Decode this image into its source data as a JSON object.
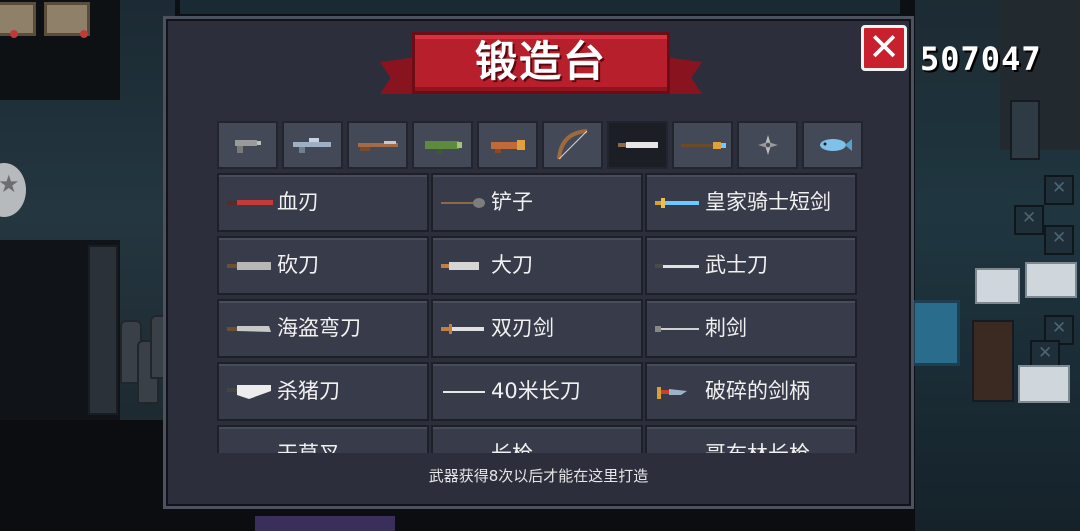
{
  "window": {
    "title": "锻造台"
  },
  "currency": {
    "gems": "507047"
  },
  "close_button": {
    "label": "✕"
  },
  "categories": [
    {
      "icon": "pistol-icon",
      "active": false
    },
    {
      "icon": "rifle-icon",
      "active": false
    },
    {
      "icon": "shotgun-icon",
      "active": false
    },
    {
      "icon": "rocket-launcher-icon",
      "active": false
    },
    {
      "icon": "special-gun-icon",
      "active": false
    },
    {
      "icon": "bow-icon",
      "active": false
    },
    {
      "icon": "blade-icon",
      "active": true
    },
    {
      "icon": "spear-icon",
      "active": false
    },
    {
      "icon": "shuriken-icon",
      "active": false
    },
    {
      "icon": "fish-icon",
      "active": false
    }
  ],
  "weapons": [
    {
      "name": "血刃",
      "icon": "blood-blade-icon",
      "color": "#c23a3a"
    },
    {
      "name": "铲子",
      "icon": "shovel-icon",
      "color": "#7d7d7d"
    },
    {
      "name": "皇家骑士短剑",
      "icon": "royal-knight-sword-icon",
      "color": "#6ec7ff"
    },
    {
      "name": "砍刀",
      "icon": "machete-icon",
      "color": "#b7b7b7"
    },
    {
      "name": "大刀",
      "icon": "broadsword-icon",
      "color": "#d6d6d6"
    },
    {
      "name": "武士刀",
      "icon": "katana-icon",
      "color": "#e0e0e0"
    },
    {
      "name": "海盗弯刀",
      "icon": "pirate-cutlass-icon",
      "color": "#c9c9c9"
    },
    {
      "name": "双刃剑",
      "icon": "double-edge-sword-icon",
      "color": "#e0e0e0"
    },
    {
      "name": "刺剑",
      "icon": "rapier-icon",
      "color": "#d0d0d0"
    },
    {
      "name": "杀猪刀",
      "icon": "butcher-knife-icon",
      "color": "#ececec"
    },
    {
      "name": "40米长刀",
      "icon": "long-blade-icon",
      "color": "#e8e8e8"
    },
    {
      "name": "破碎的剑柄",
      "icon": "broken-hilt-icon",
      "color": "#9fb3c8"
    },
    {
      "name": "干草叉",
      "icon": "pitchfork-icon",
      "color": "#a0a0a0"
    },
    {
      "name": "长枪",
      "icon": "lance-icon",
      "color": "#a0a0a0"
    },
    {
      "name": "哥布林长枪",
      "icon": "goblin-spear-icon",
      "color": "#a0a0a0"
    }
  ],
  "footer": {
    "note": "武器获得8次以后才能在这里打造"
  }
}
